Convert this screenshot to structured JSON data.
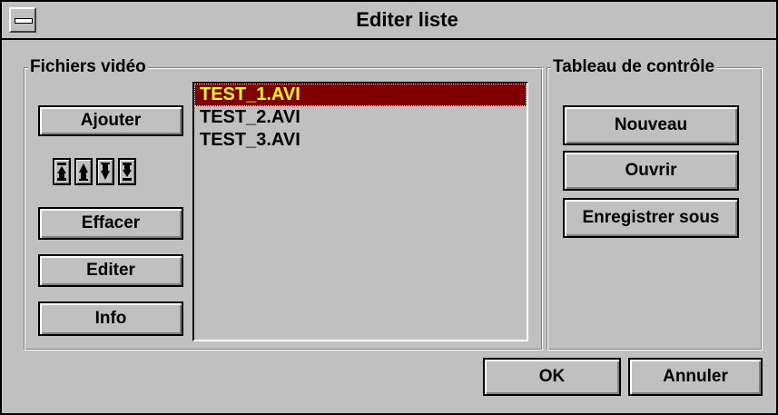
{
  "window": {
    "title": "Editer liste"
  },
  "video_group": {
    "legend": "Fichiers vidéo",
    "add_label": "Ajouter",
    "delete_label": "Effacer",
    "edit_label": "Editer",
    "info_label": "Info",
    "move_buttons": [
      "move-top-icon",
      "move-up-icon",
      "move-down-icon",
      "move-bottom-icon"
    ]
  },
  "file_list": {
    "items": [
      "TEST_1.AVI",
      "TEST_2.AVI",
      "TEST_3.AVI"
    ],
    "selected": "TEST_1.AVI"
  },
  "control_group": {
    "legend": "Tableau de contrôle",
    "new_label": "Nouveau",
    "open_label": "Ouvrir",
    "save_as_label": "Enregistrer sous"
  },
  "footer": {
    "ok_label": "OK",
    "cancel_label": "Annuler"
  },
  "colors": {
    "face": "#c0c0c0",
    "selection_bg": "#800000",
    "selection_fg": "#ffff00"
  }
}
